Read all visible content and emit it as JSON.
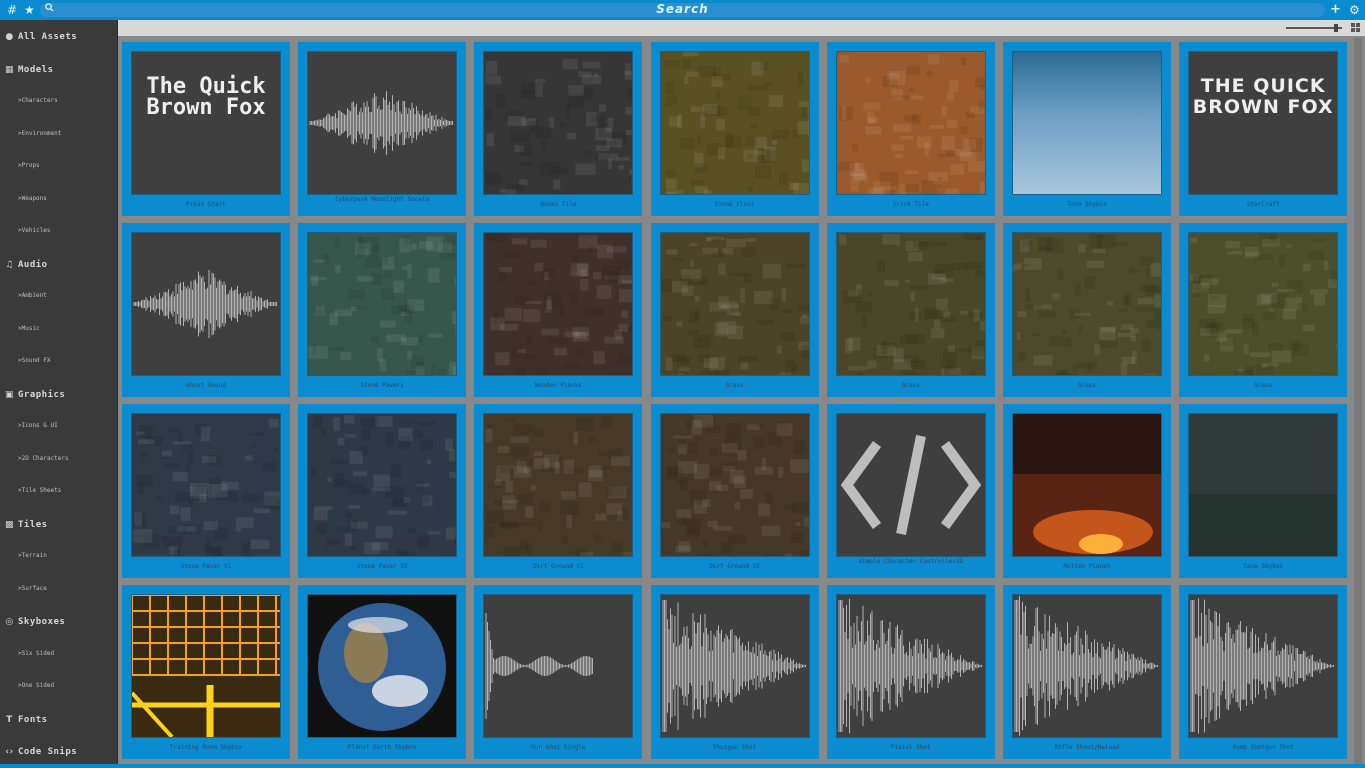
{
  "topbar": {
    "search_title": "Search",
    "left_icons": [
      "hash-icon",
      "star-icon",
      "search-icon"
    ],
    "right_icons": [
      "plus-icon",
      "gear-icon"
    ],
    "accent": "#0a8bd0"
  },
  "sidebar": {
    "items": [
      {
        "label": "All Assets",
        "type": "cat",
        "icon": "circle-icon"
      },
      {
        "label": "Models",
        "type": "cat",
        "icon": "cube-icon"
      },
      {
        "label": ">Characters",
        "type": "sub"
      },
      {
        "label": ">Environment",
        "type": "sub"
      },
      {
        "label": ">Props",
        "type": "sub"
      },
      {
        "label": ">Weapons",
        "type": "sub"
      },
      {
        "label": ">Vehicles",
        "type": "sub"
      },
      {
        "label": "Audio",
        "type": "cat",
        "icon": "audio-icon"
      },
      {
        "label": ">Ambient",
        "type": "sub"
      },
      {
        "label": ">Music",
        "type": "sub"
      },
      {
        "label": ">Sound FX",
        "type": "sub"
      },
      {
        "label": "Graphics",
        "type": "cat",
        "icon": "image-icon"
      },
      {
        "label": ">Icons & UI",
        "type": "sub"
      },
      {
        "label": ">2D Characters",
        "type": "sub"
      },
      {
        "label": ">Tile Sheets",
        "type": "sub"
      },
      {
        "label": "Tiles",
        "type": "cat",
        "icon": "tiles-icon"
      },
      {
        "label": ">Terrain",
        "type": "sub"
      },
      {
        "label": ">Surface",
        "type": "sub"
      },
      {
        "label": "Skyboxes",
        "type": "cat",
        "icon": "skybox-icon"
      },
      {
        "label": ">Six Sided",
        "type": "sub"
      },
      {
        "label": ">One Sided",
        "type": "sub"
      },
      {
        "label": "Fonts",
        "type": "cat",
        "icon": "font-icon"
      },
      {
        "label": "Code Snips",
        "type": "cat",
        "icon": "code-icon"
      }
    ]
  },
  "assets": [
    {
      "label": "Press Start",
      "kind": "font",
      "text": "The Quick Brown Fox"
    },
    {
      "label": "Cyberpunk Moonlight Sonata",
      "kind": "wave"
    },
    {
      "label": "Bones Tile",
      "kind": "texture",
      "color": "#363636"
    },
    {
      "label": "Stone Floor",
      "kind": "texture",
      "color": "#5a5123"
    },
    {
      "label": "Brick Tile",
      "kind": "texture",
      "color": "#9a5a2c"
    },
    {
      "label": "Toon Skybox",
      "kind": "sky"
    },
    {
      "label": "StarCraft",
      "kind": "font",
      "text": "THE QUICK BROWN FOX"
    },
    {
      "label": "Ghost Sound",
      "kind": "wave"
    },
    {
      "label": "Stone Pavers",
      "kind": "texture",
      "color": "#38574c"
    },
    {
      "label": "Wooden Planks",
      "kind": "texture",
      "color": "#3f3129"
    },
    {
      "label": "Grass",
      "kind": "texture",
      "color": "#4b4427"
    },
    {
      "label": "Grass",
      "kind": "texture",
      "color": "#4a4628"
    },
    {
      "label": "Grass",
      "kind": "texture",
      "color": "#4d4a2b"
    },
    {
      "label": "Grass",
      "kind": "texture",
      "color": "#4d4f2a"
    },
    {
      "label": "Stone Paver V1",
      "kind": "texture",
      "color": "#2f3a46"
    },
    {
      "label": "Stone Paver V2",
      "kind": "texture",
      "color": "#2f3845"
    },
    {
      "label": "Dirt Ground V1",
      "kind": "texture",
      "color": "#463a27"
    },
    {
      "label": "Dirt Ground V2",
      "kind": "texture",
      "color": "#453828"
    },
    {
      "label": "Simple Character Controller2D",
      "kind": "code"
    },
    {
      "label": "Molten Planet",
      "kind": "molten"
    },
    {
      "label": "Cave Skybox",
      "kind": "cave"
    },
    {
      "label": "Training Room Skybox",
      "kind": "room"
    },
    {
      "label": "Planet Earth Skybox",
      "kind": "earth"
    },
    {
      "label": "Gun Shot Single",
      "kind": "wave2"
    },
    {
      "label": "Shotgun Shot",
      "kind": "wave3"
    },
    {
      "label": "Pistol Shot",
      "kind": "wave3"
    },
    {
      "label": "Rifle Shoot/Reload",
      "kind": "wave3"
    },
    {
      "label": "Pump Shotgun Shot",
      "kind": "wave3"
    }
  ]
}
